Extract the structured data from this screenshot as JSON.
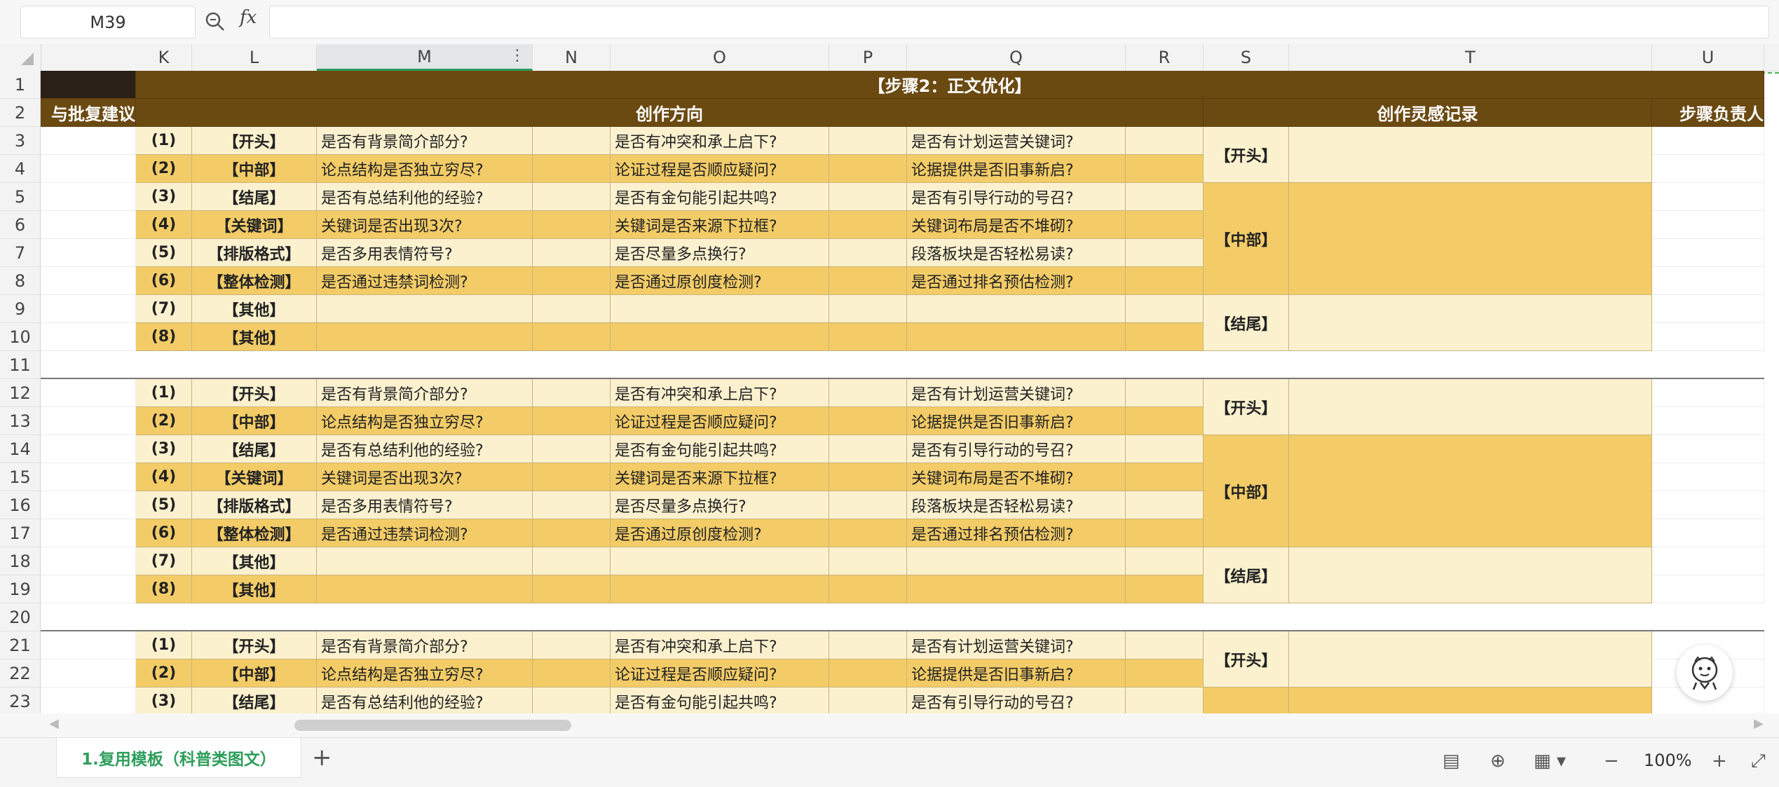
{
  "formula_bar": {
    "cell_ref": "M39",
    "fx_label": "fx",
    "formula": ""
  },
  "columns": [
    "K",
    "L",
    "M",
    "N",
    "O",
    "P",
    "Q",
    "R",
    "S",
    "T",
    "U"
  ],
  "selected_column": "M",
  "rows": [
    "1",
    "2",
    "3",
    "4",
    "5",
    "6",
    "7",
    "8",
    "9",
    "10",
    "11",
    "12",
    "13",
    "14",
    "15",
    "16",
    "17",
    "18",
    "19",
    "20",
    "21",
    "22",
    "23"
  ],
  "header": {
    "step_title": "【步骤2：正文优化】",
    "left_cut": "与批复建议",
    "direction": "创作方向",
    "inspiration": "创作灵感记录",
    "owner_cut": "步骤负责人"
  },
  "checklist": [
    {
      "num": "(1)",
      "part": "【开头】",
      "q1": "是否有背景简介部分?",
      "q2": "是否有冲突和承上启下?",
      "q3": "是否有计划运营关键词?"
    },
    {
      "num": "(2)",
      "part": "【中部】",
      "q1": "论点结构是否独立穷尽?",
      "q2": "论证过程是否顺应疑问?",
      "q3": "论据提供是否旧事新启?"
    },
    {
      "num": "(3)",
      "part": "【结尾】",
      "q1": "是否有总结利他的经验?",
      "q2": "是否有金句能引起共鸣?",
      "q3": "是否有引导行动的号召?"
    },
    {
      "num": "(4)",
      "part": "【关键词】",
      "q1": "关键词是否出现3次?",
      "q2": "关键词是否来源下拉框?",
      "q3": "关键词布局是否不堆砌?"
    },
    {
      "num": "(5)",
      "part": "【排版格式】",
      "q1": "是否多用表情符号?",
      "q2": "是否尽量多点换行?",
      "q3": "段落板块是否轻松易读?"
    },
    {
      "num": "(6)",
      "part": "【整体检测】",
      "q1": "是否通过违禁词检测?",
      "q2": "是否通过原创度检测?",
      "q3": "是否通过排名预估检测?"
    },
    {
      "num": "(7)",
      "part": "【其他】",
      "q1": "",
      "q2": "",
      "q3": ""
    },
    {
      "num": "(8)",
      "part": "【其他】",
      "q1": "",
      "q2": "",
      "q3": ""
    }
  ],
  "sections": {
    "open": "【开头】",
    "mid": "【中部】",
    "end": "【结尾】"
  },
  "sheet_tab": "1.复用模板（科普类图文）",
  "zoom": "100%",
  "colors": {
    "dark_header": "#6b4a12",
    "light_row": "#fbf1cf",
    "dark_row": "#f3cc67",
    "accent": "#2e9e5b"
  }
}
